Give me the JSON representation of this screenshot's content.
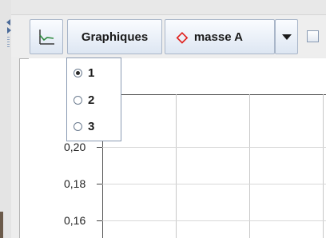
{
  "toolbar": {
    "graph_icon": "line-graph-icon",
    "graphiques_label": "Graphiques",
    "series_label": "masse A",
    "series_marker": "◇",
    "series_marker_color": "#e0201c",
    "dropdown_icon": "chevron-down-icon"
  },
  "graph_menu": {
    "items": [
      {
        "label": "1",
        "selected": true
      },
      {
        "label": "2",
        "selected": false
      },
      {
        "label": "3",
        "selected": false
      }
    ]
  },
  "chart": {
    "y_tick_labels": [
      "0,20",
      "0,18",
      "0,16"
    ]
  }
}
